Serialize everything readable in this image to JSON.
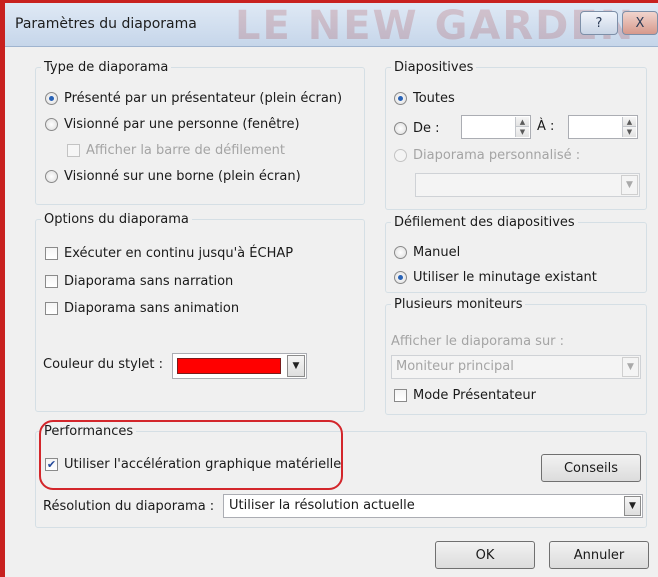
{
  "window": {
    "title": "Paramètres du diaporama",
    "watermark": "LE NEW GARDEN",
    "help_label": "?",
    "close_label": "X"
  },
  "type_group": {
    "legend": "Type de diaporama",
    "option_presenter": "Présenté par un présentateur (plein écran)",
    "option_individual": "Visionné par une personne (fenêtre)",
    "show_scrollbar": "Afficher la barre de défilement",
    "option_kiosk": "Visionné sur une borne (plein écran)",
    "selected": "presenter"
  },
  "slides_group": {
    "legend": "Diapositives",
    "option_all": "Toutes",
    "option_from": "De :",
    "to_label": "À :",
    "from_value": "",
    "to_value": "",
    "option_custom": "Diaporama personnalisé :",
    "custom_value": "",
    "selected": "all"
  },
  "options_group": {
    "legend": "Options du diaporama",
    "loop": "Exécuter en continu jusqu'à ÉCHAP",
    "no_narration": "Diaporama sans narration",
    "no_animation": "Diaporama sans animation",
    "pen_color_label": "Couleur du stylet :",
    "pen_color": "#ff0000"
  },
  "advance_group": {
    "legend": "Défilement des diapositives",
    "option_manual": "Manuel",
    "option_timings": "Utiliser le minutage existant",
    "selected": "timings"
  },
  "monitors_group": {
    "legend": "Plusieurs moniteurs",
    "show_on_label": "Afficher le diaporama sur :",
    "monitor_value": "Moniteur principal",
    "presenter_view": "Mode Présentateur"
  },
  "performance_group": {
    "legend": "Performances",
    "hw_accel": "Utiliser l'accélération graphique matérielle",
    "hw_accel_checked": true,
    "tips_button": "Conseils",
    "resolution_label": "Résolution du diaporama :",
    "resolution_value": "Utiliser la résolution actuelle"
  },
  "footer": {
    "ok_button": "OK",
    "cancel_button": "Annuler"
  }
}
